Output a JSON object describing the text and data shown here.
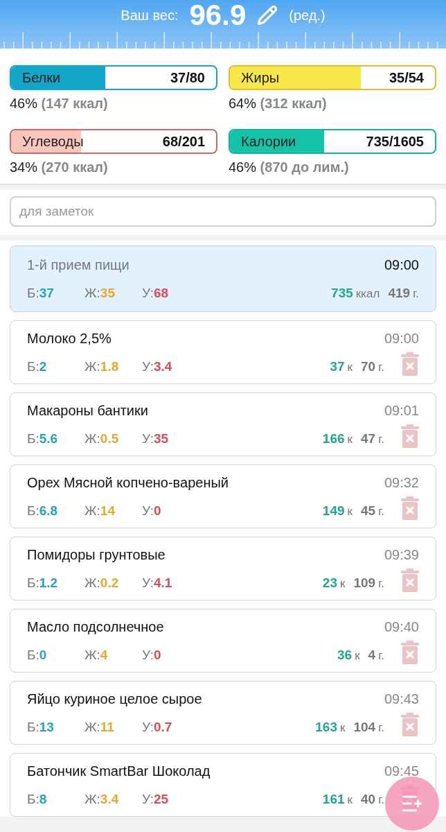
{
  "header": {
    "label": "Ваш вес:",
    "weight": "96.9",
    "edit": "(ред.)"
  },
  "macros": [
    {
      "name": "Белки",
      "value": "37/80",
      "level": 0.46,
      "color": "#13a6c9",
      "percent": "46%",
      "detail": "(147 ккал)"
    },
    {
      "name": "Жиры",
      "value": "35/54",
      "level": 0.64,
      "color": "#f8e84a",
      "percent": "64%",
      "detail": "(312 ккал)"
    },
    {
      "name": "Углеводы",
      "value": "68/201",
      "level": 0.34,
      "color": "#f9c6bc",
      "percent": "34%",
      "detail": "(270 ккал)"
    },
    {
      "name": "Калории",
      "value": "735/1605",
      "level": 0.46,
      "color": "#14c3a8",
      "percent": "46%",
      "detail": "(870 до лим.)"
    }
  ],
  "notes": {
    "placeholder": "для заметок"
  },
  "entries": [
    {
      "kind": "meal",
      "selected": true,
      "title": "1-й прием пищи",
      "time": "09:00",
      "nutrients": [
        {
          "label": "Б:",
          "value": "37"
        },
        {
          "label": "Ж:",
          "value": "35"
        },
        {
          "label": "У:",
          "value": "68"
        }
      ],
      "kcal": "735",
      "kcal_unit": "ккал",
      "grams": "419",
      "grams_unit": "г."
    },
    {
      "kind": "food",
      "selected": false,
      "title": "Молоко 2,5%",
      "time": "09:00",
      "nutrients": [
        {
          "label": "Б:",
          "value": "2"
        },
        {
          "label": "Ж:",
          "value": "1.8"
        },
        {
          "label": "У:",
          "value": "3.4"
        }
      ],
      "kcal": "37",
      "kcal_unit": "к",
      "grams": "70",
      "grams_unit": "г."
    },
    {
      "kind": "food",
      "selected": false,
      "title": "Макароны бантики",
      "time": "09:01",
      "nutrients": [
        {
          "label": "Б:",
          "value": "5.6"
        },
        {
          "label": "Ж:",
          "value": "0.5"
        },
        {
          "label": "У:",
          "value": "35"
        }
      ],
      "kcal": "166",
      "kcal_unit": "к",
      "grams": "47",
      "grams_unit": "г."
    },
    {
      "kind": "food",
      "selected": false,
      "title": "Орех Мясной копчено-вареный",
      "time": "09:32",
      "nutrients": [
        {
          "label": "Б:",
          "value": "6.8"
        },
        {
          "label": "Ж:",
          "value": "14"
        },
        {
          "label": "У:",
          "value": "0"
        }
      ],
      "kcal": "149",
      "kcal_unit": "к",
      "grams": "45",
      "grams_unit": "г."
    },
    {
      "kind": "food",
      "selected": false,
      "title": "Помидоры грунтовые",
      "time": "09:39",
      "nutrients": [
        {
          "label": "Б:",
          "value": "1.2"
        },
        {
          "label": "Ж:",
          "value": "0.2"
        },
        {
          "label": "У:",
          "value": "4.1"
        }
      ],
      "kcal": "23",
      "kcal_unit": "к",
      "grams": "109",
      "grams_unit": "г."
    },
    {
      "kind": "food",
      "selected": false,
      "title": "Масло подсолнечное",
      "time": "09:40",
      "nutrients": [
        {
          "label": "Б:",
          "value": "0"
        },
        {
          "label": "Ж:",
          "value": "4"
        },
        {
          "label": "У:",
          "value": "0"
        }
      ],
      "kcal": "36",
      "kcal_unit": "к",
      "grams": "4",
      "grams_unit": "г."
    },
    {
      "kind": "food",
      "selected": false,
      "title": "Яйцо куриное целое сырое",
      "time": "09:43",
      "nutrients": [
        {
          "label": "Б:",
          "value": "13"
        },
        {
          "label": "Ж:",
          "value": "11"
        },
        {
          "label": "У:",
          "value": "0.7"
        }
      ],
      "kcal": "163",
      "kcal_unit": "к",
      "grams": "104",
      "grams_unit": "г."
    },
    {
      "kind": "food",
      "selected": false,
      "title": "Батончик SmartBar Шоколад",
      "time": "09:45",
      "nutrients": [
        {
          "label": "Б:",
          "value": "8"
        },
        {
          "label": "Ж:",
          "value": "3.4"
        },
        {
          "label": "У:",
          "value": "25"
        }
      ],
      "kcal": "161",
      "kcal_unit": "к",
      "grams": "40",
      "grams_unit": "г."
    }
  ]
}
